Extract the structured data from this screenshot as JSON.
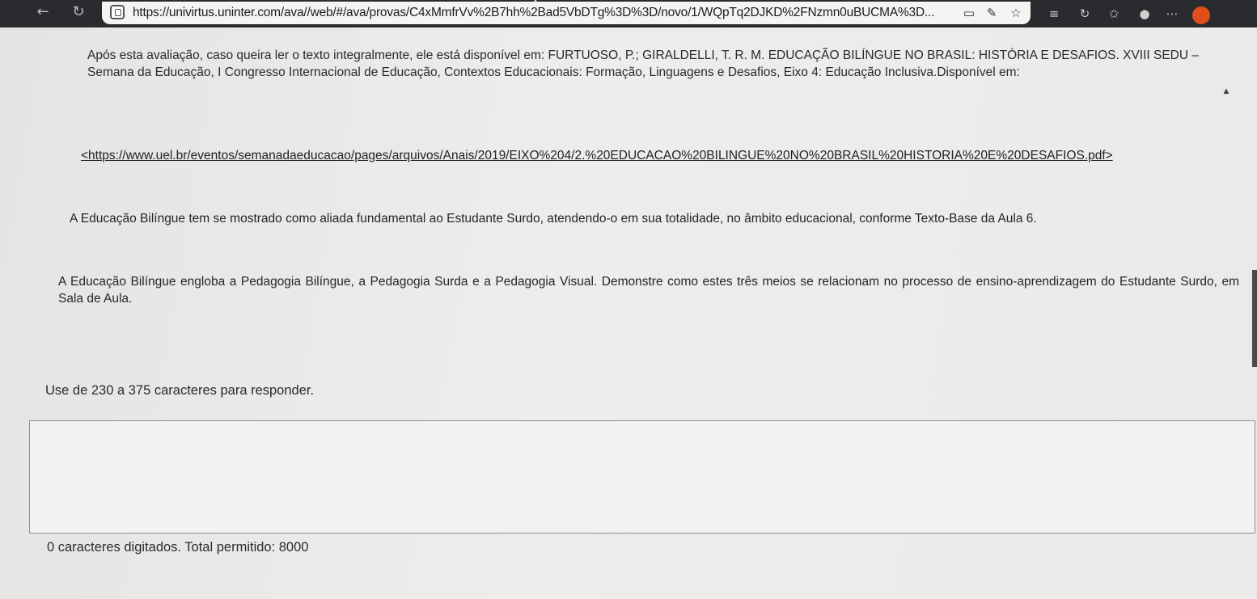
{
  "browser": {
    "url": "https://univirtus.uninter.com/ava//web/#/ava/provas/C4xMmfrVv%2B7hh%2Bad5VbDTg%3D%3D/novo/1/WQpTq2DJKD%2FNzmn0uBUCMA%3D...",
    "back_icon": "←",
    "reload_icon": "↻",
    "close_tab_icon": "×"
  },
  "content": {
    "reference_text": "Após esta avaliação, caso queira ler o texto integralmente, ele está disponível em: FURTUOSO, P.; GIRALDELLI, T. R. M. EDUCAÇÃO BILÍNGUE NO BRASIL: HISTÓRIA E DESAFIOS. XVIII SEDU – Semana da Educação, I Congresso Internacional de Educação, Contextos Educacionais: Formação, Linguagens e Desafios, Eixo 4: Educação Inclusiva.Disponível em:",
    "reference_link": "<https://www.uel.br/eventos/semanadaeducacao/pages/arquivos/Anais/2019/EIXO%204/2.%20EDUCACAO%20BILINGUE%20NO%20BRASIL%20HISTORIA%20E%20DESAFIOS.pdf>",
    "question_intro": "A Educação Bilíngue tem se mostrado como aliada fundamental ao Estudante Surdo, atendendo-o em sua totalidade, no âmbito educacional, conforme Texto-Base da Aula 6.",
    "question_prompt": "A Educação Bilíngue engloba a Pedagogia Bilíngue, a Pedagogia Surda e a Pedagogia Visual. Demonstre como estes três meios se relacionam no processo de ensino-aprendizagem do Estudante Surdo, em Sala de Aula.",
    "hint": "Use de 230 a 375 caracteres para responder.",
    "answer_value": "",
    "counter": "0 caracteres digitados. Total permitido: 8000"
  }
}
